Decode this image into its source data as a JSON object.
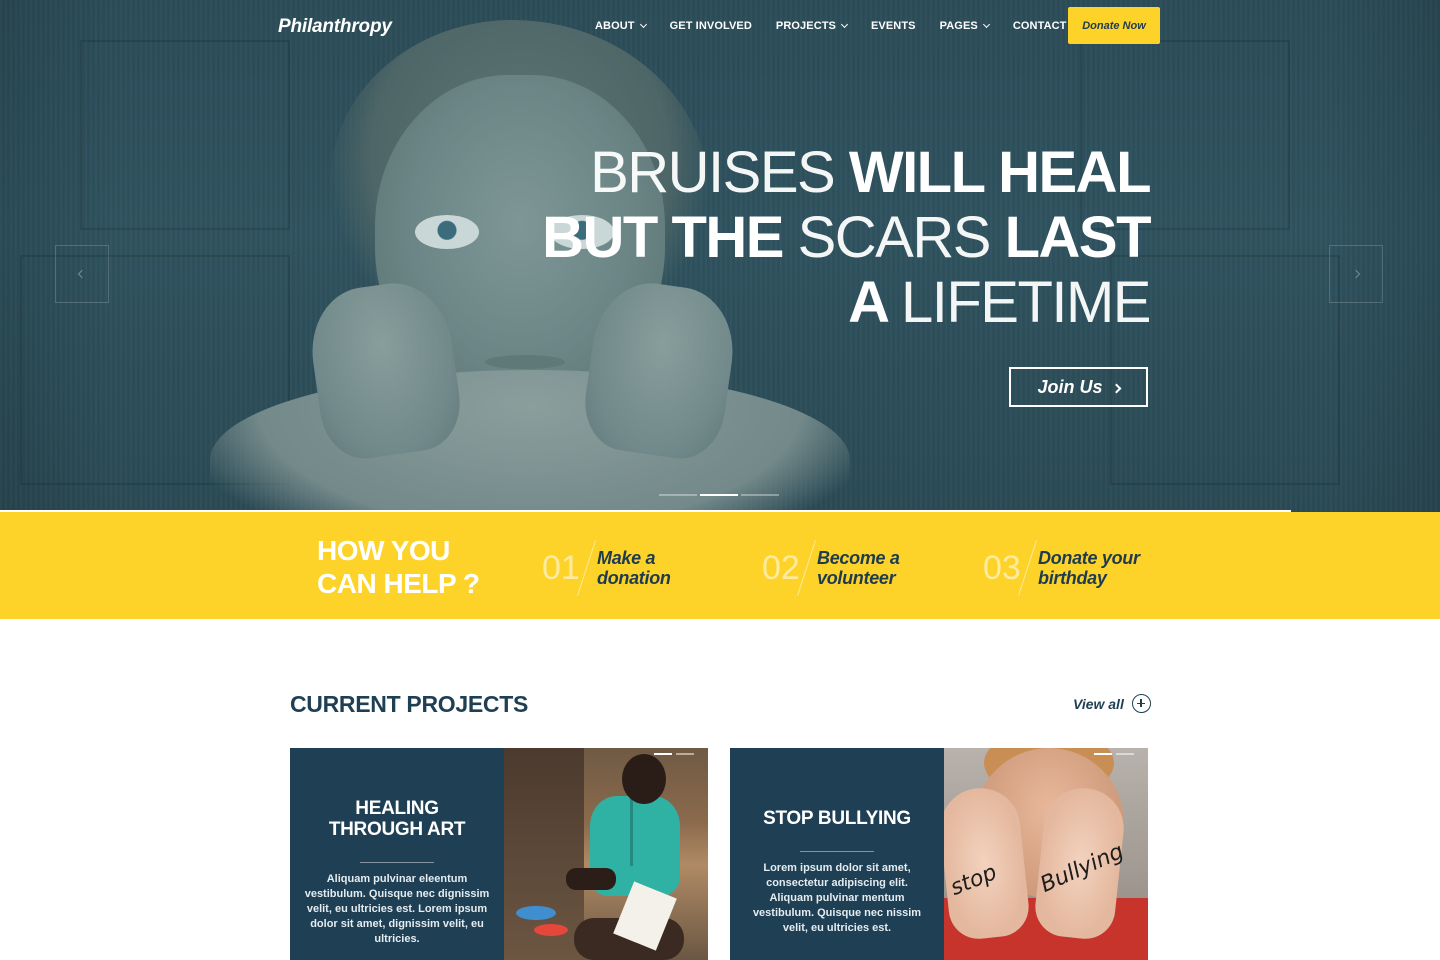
{
  "brand": {
    "logo": "Philanthropy"
  },
  "nav": {
    "items": [
      {
        "label": "ABOUT",
        "dropdown": true
      },
      {
        "label": "GET INVOLVED",
        "dropdown": false
      },
      {
        "label": "PROJECTS",
        "dropdown": true
      },
      {
        "label": "EVENTS",
        "dropdown": false
      },
      {
        "label": "PAGES",
        "dropdown": true
      },
      {
        "label": "CONTACT",
        "dropdown": false
      }
    ],
    "cta": "Donate Now"
  },
  "hero": {
    "line1_thin": "BRUISES",
    "line1_bold": "WILL HEAL",
    "line2_bold": "BUT THE",
    "line2_thin": "SCARS",
    "line2_bold2": "LAST",
    "line3_bold": "A",
    "line3_thin": "LIFETIME",
    "button": "Join Us",
    "slides": 3,
    "active_slide": 2
  },
  "help": {
    "title_line1": "HOW YOU",
    "title_line2": "CAN HELP ?",
    "items": [
      {
        "num": "01",
        "line1": "Make a",
        "line2": "donation"
      },
      {
        "num": "02",
        "line1": "Become a",
        "line2": "volunteer"
      },
      {
        "num": "03",
        "line1": "Donate your",
        "line2": "birthday"
      }
    ]
  },
  "projects": {
    "title": "CURRENT PROJECTS",
    "view_all": "View all",
    "cards": [
      {
        "title_line1": "HEALING",
        "title_line2": "THROUGH ART",
        "description": "Aliquam pulvinar eleentum vestibulum. Quisque nec dignissim velit, eu ultricies est. Lorem ipsum dolor sit amet, dignissim velit, eu ultricies."
      },
      {
        "title_line1": "STOP BULLYING",
        "title_line2": "",
        "description": "Lorem ipsum dolor sit amet, consectetur adipiscing elit. Aliquam pulvinar mentum vestibulum. Quisque nec nissim velit, eu ultricies est.",
        "photo_words": [
          "stop",
          "Bullying"
        ]
      }
    ]
  },
  "colors": {
    "accent_yellow": "#fdd32a",
    "navy": "#1f3f54",
    "hero_overlay": "#2f535f"
  }
}
